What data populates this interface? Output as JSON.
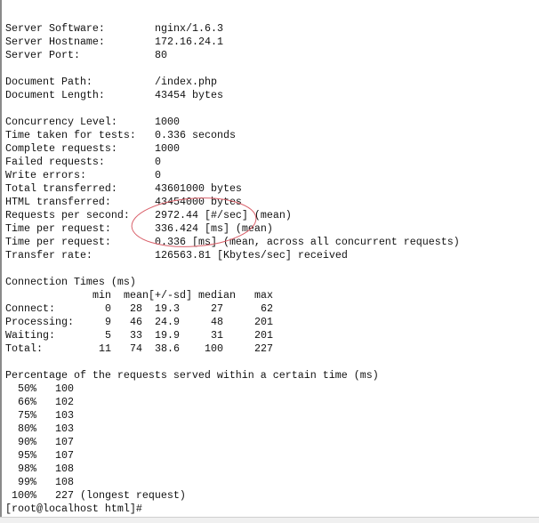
{
  "summary": [
    {
      "label": "Server Software:",
      "value": "nginx/1.6.3"
    },
    {
      "label": "Server Hostname:",
      "value": "172.16.24.1"
    },
    {
      "label": "Server Port:",
      "value": "80"
    },
    null,
    {
      "label": "Document Path:",
      "value": "/index.php"
    },
    {
      "label": "Document Length:",
      "value": "43454 bytes"
    },
    null,
    {
      "label": "Concurrency Level:",
      "value": "1000"
    },
    {
      "label": "Time taken for tests:",
      "value": "0.336 seconds"
    },
    {
      "label": "Complete requests:",
      "value": "1000"
    },
    {
      "label": "Failed requests:",
      "value": "0"
    },
    {
      "label": "Write errors:",
      "value": "0"
    },
    {
      "label": "Total transferred:",
      "value": "43601000 bytes"
    },
    {
      "label": "HTML transferred:",
      "value": "43454000 bytes"
    },
    {
      "label": "Requests per second:",
      "value": "2972.44 [#/sec] (mean)"
    },
    {
      "label": "Time per request:",
      "value": "336.424 [ms] (mean)"
    },
    {
      "label": "Time per request:",
      "value": "0.336 [ms] (mean, across all concurrent requests)"
    },
    {
      "label": "Transfer rate:",
      "value": "126563.81 [Kbytes/sec] received"
    }
  ],
  "connection_times": {
    "title": "Connection Times (ms)",
    "headers": [
      "min",
      "mean[+/-sd]",
      "median",
      "max"
    ],
    "rows": [
      {
        "label": "Connect:",
        "min": "0",
        "mean": "28",
        "sd": "19.3",
        "median": "27",
        "max": "62"
      },
      {
        "label": "Processing:",
        "min": "9",
        "mean": "46",
        "sd": "24.9",
        "median": "48",
        "max": "201"
      },
      {
        "label": "Waiting:",
        "min": "5",
        "mean": "33",
        "sd": "19.9",
        "median": "31",
        "max": "201"
      },
      {
        "label": "Total:",
        "min": "11",
        "mean": "74",
        "sd": "38.6",
        "median": "100",
        "max": "227"
      }
    ]
  },
  "percentiles": {
    "title": "Percentage of the requests served within a certain time (ms)",
    "rows": [
      {
        "pct": "50%",
        "value": "100"
      },
      {
        "pct": "66%",
        "value": "102"
      },
      {
        "pct": "75%",
        "value": "103"
      },
      {
        "pct": "80%",
        "value": "103"
      },
      {
        "pct": "90%",
        "value": "107"
      },
      {
        "pct": "95%",
        "value": "107"
      },
      {
        "pct": "98%",
        "value": "108"
      },
      {
        "pct": "99%",
        "value": "108"
      },
      {
        "pct": "100%",
        "value": "227 (longest request)"
      }
    ]
  },
  "prompt": "[root@localhost html]#",
  "annotation_color": "#d9606a"
}
